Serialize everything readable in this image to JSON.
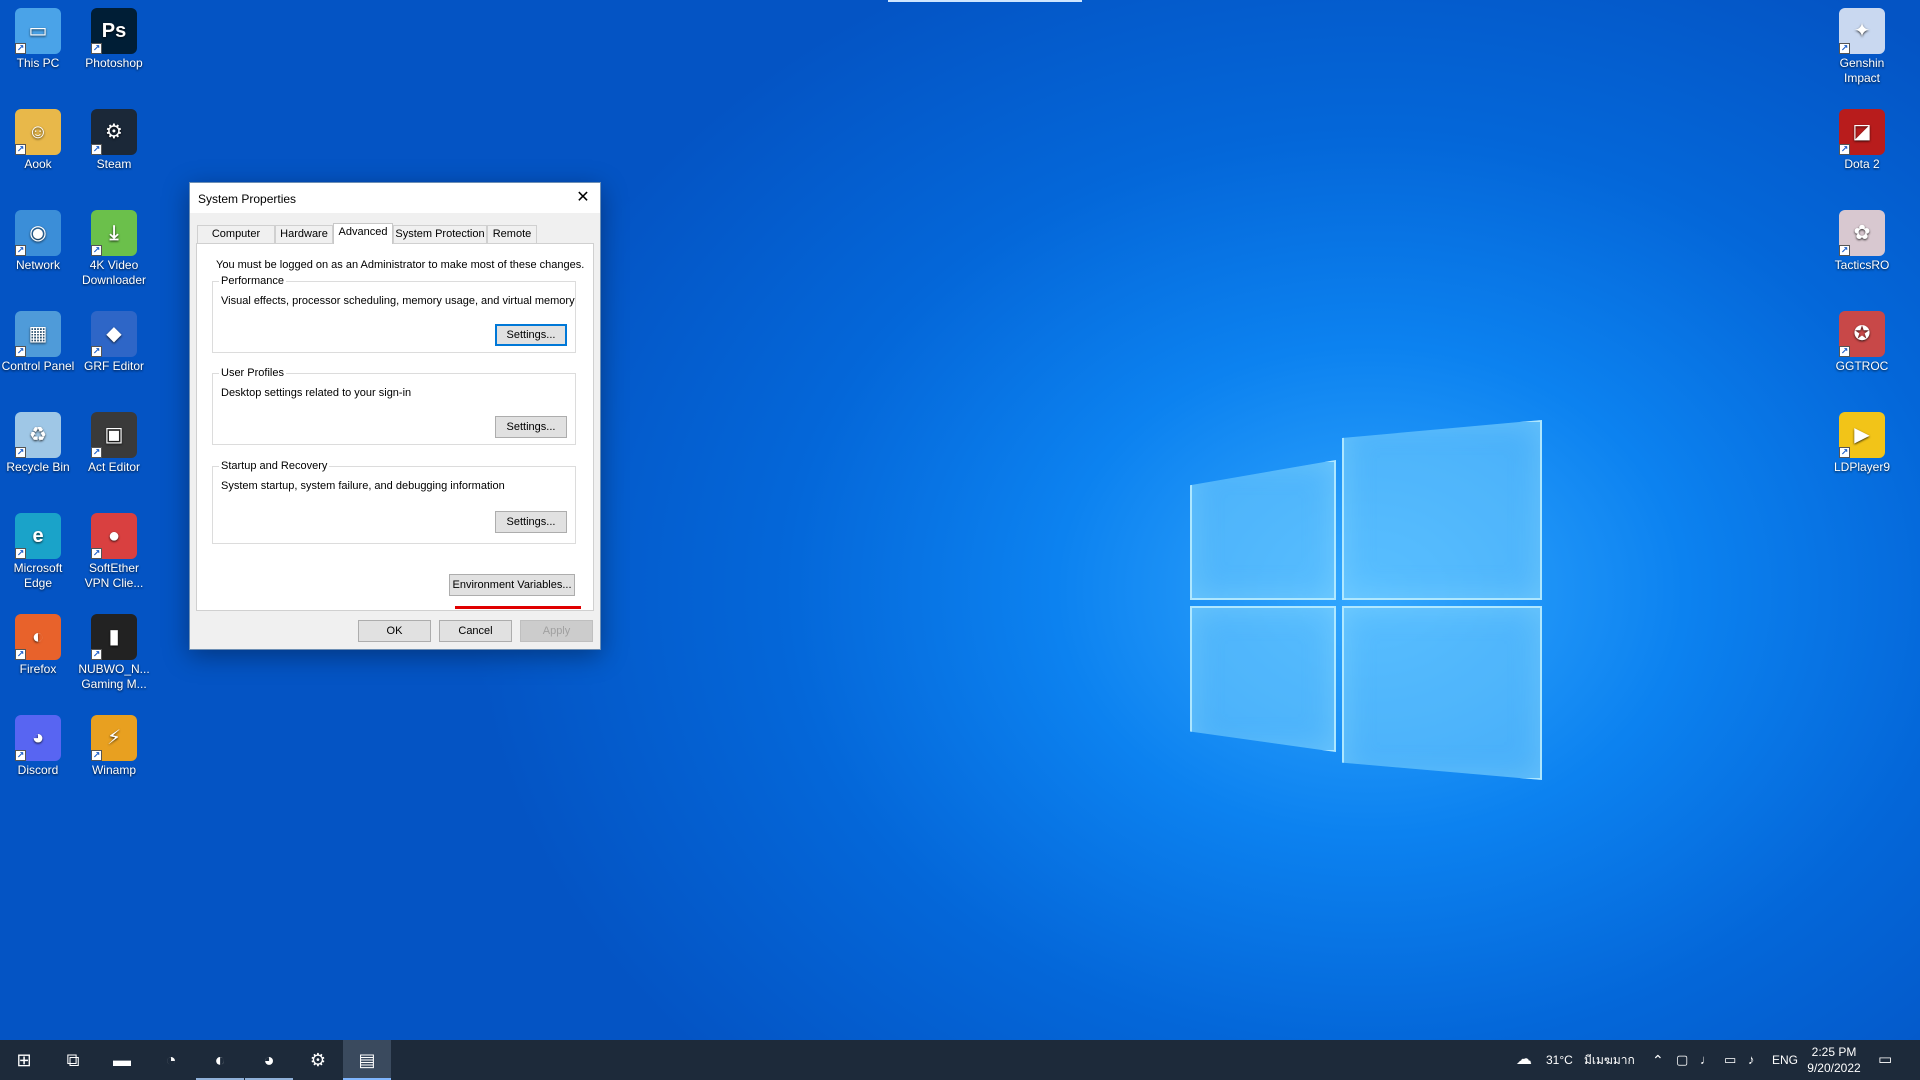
{
  "desktop": {
    "left_icons": [
      {
        "label": "This PC",
        "icon": "this-pc-icon",
        "color": "#4aa3e8",
        "glyph": "▭"
      },
      {
        "label": "Photoshop",
        "icon": "photoshop-icon",
        "color": "#001e36",
        "glyph": "Ps"
      },
      {
        "label": "Aook",
        "icon": "user-folder-icon",
        "color": "#e8b84a",
        "glyph": "☺"
      },
      {
        "label": "Steam",
        "icon": "steam-icon",
        "color": "#1b2838",
        "glyph": "⚙"
      },
      {
        "label": "Network",
        "icon": "network-icon",
        "color": "#3b8ed8",
        "glyph": "◉"
      },
      {
        "label": "4K Video Downloader",
        "icon": "video-downloader-icon",
        "color": "#6bc04b",
        "glyph": "⤓"
      },
      {
        "label": "Control Panel",
        "icon": "control-panel-icon",
        "color": "#4f9bd9",
        "glyph": "▦"
      },
      {
        "label": "GRF Editor",
        "icon": "grf-editor-icon",
        "color": "#2e66c7",
        "glyph": "◆"
      },
      {
        "label": "Recycle Bin",
        "icon": "recycle-bin-icon",
        "color": "#9fc7e6",
        "glyph": "♻"
      },
      {
        "label": "Act Editor",
        "icon": "act-editor-icon",
        "color": "#3a3a3a",
        "glyph": "▣"
      },
      {
        "label": "Microsoft Edge",
        "icon": "edge-icon",
        "color": "#1aa3c9",
        "glyph": "e"
      },
      {
        "label": "SoftEther VPN Clie...",
        "icon": "softether-vpn-icon",
        "color": "#d94040",
        "glyph": "●"
      },
      {
        "label": "Firefox",
        "icon": "firefox-icon",
        "color": "#e8622b",
        "glyph": "◐"
      },
      {
        "label": "NUBWO_N... Gaming M...",
        "icon": "gaming-mouse-icon",
        "color": "#222222",
        "glyph": "▮"
      },
      {
        "label": "Discord",
        "icon": "discord-icon",
        "color": "#5865f2",
        "glyph": "◕"
      },
      {
        "label": "Winamp",
        "icon": "winamp-icon",
        "color": "#e8a020",
        "glyph": "⚡"
      }
    ],
    "right_icons": [
      {
        "label": "Genshin Impact",
        "icon": "genshin-impact-icon",
        "color": "#c9d8f0",
        "glyph": "✦"
      },
      {
        "label": "Dota 2",
        "icon": "dota2-icon",
        "color": "#b81c1c",
        "glyph": "◪"
      },
      {
        "label": "TacticsRO",
        "icon": "tacticsro-icon",
        "color": "#d8c8d0",
        "glyph": "✿"
      },
      {
        "label": "GGTROC",
        "icon": "ggtroc-icon",
        "color": "#c84848",
        "glyph": "✪"
      },
      {
        "label": "LDPlayer9",
        "icon": "ldplayer-icon",
        "color": "#f2c418",
        "glyph": "▶"
      }
    ]
  },
  "dialog": {
    "title": "System Properties",
    "close_glyph": "✕",
    "tabs": [
      {
        "label": "Computer Name"
      },
      {
        "label": "Hardware"
      },
      {
        "label": "Advanced"
      },
      {
        "label": "System Protection"
      },
      {
        "label": "Remote"
      }
    ],
    "note": "You must be logged on as an Administrator to make most of these changes.",
    "performance": {
      "title": "Performance",
      "desc": "Visual effects, processor scheduling, memory usage, and virtual memory",
      "button": "Settings..."
    },
    "user_profiles": {
      "title": "User Profiles",
      "desc": "Desktop settings related to your sign-in",
      "button": "Settings..."
    },
    "startup": {
      "title": "Startup and Recovery",
      "desc": "System startup, system failure, and debugging information",
      "button": "Settings..."
    },
    "env_button": "Environment Variables...",
    "ok": "OK",
    "cancel": "Cancel",
    "apply": "Apply"
  },
  "taskbar": {
    "items": [
      {
        "name": "start-button",
        "icon": "windows-start-icon",
        "glyph": "⊞",
        "state": ""
      },
      {
        "name": "task-view-button",
        "icon": "task-view-icon",
        "glyph": "⧉",
        "state": ""
      },
      {
        "name": "file-explorer-button",
        "icon": "folder-icon",
        "glyph": "▬",
        "state": ""
      },
      {
        "name": "edge-taskbar-button",
        "icon": "edge-icon",
        "glyph": "◔",
        "state": ""
      },
      {
        "name": "firefox-taskbar-button",
        "icon": "firefox-icon",
        "glyph": "◐",
        "state": "running"
      },
      {
        "name": "discord-taskbar-button",
        "icon": "discord-icon",
        "glyph": "◕",
        "state": "running"
      },
      {
        "name": "steam-taskbar-button",
        "icon": "steam-icon",
        "glyph": "⚙",
        "state": ""
      },
      {
        "name": "system-properties-taskbar-button",
        "icon": "system-properties-icon",
        "glyph": "▤",
        "state": "active"
      }
    ],
    "weather_temp": "31°C",
    "weather_text": "มีเมฆมาก",
    "language": "ENG",
    "time": "2:25 PM",
    "date": "9/20/2022"
  }
}
